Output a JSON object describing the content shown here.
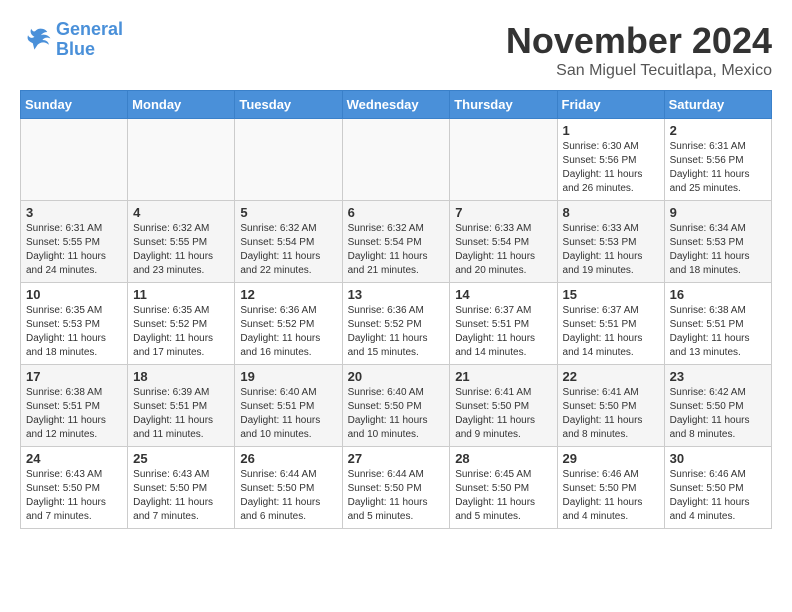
{
  "logo": {
    "line1": "General",
    "line2": "Blue"
  },
  "title": "November 2024",
  "location": "San Miguel Tecuitlapa, Mexico",
  "days_of_week": [
    "Sunday",
    "Monday",
    "Tuesday",
    "Wednesday",
    "Thursday",
    "Friday",
    "Saturday"
  ],
  "weeks": [
    {
      "days": [
        {
          "number": "",
          "info": ""
        },
        {
          "number": "",
          "info": ""
        },
        {
          "number": "",
          "info": ""
        },
        {
          "number": "",
          "info": ""
        },
        {
          "number": "",
          "info": ""
        },
        {
          "number": "1",
          "info": "Sunrise: 6:30 AM\nSunset: 5:56 PM\nDaylight: 11 hours and 26 minutes."
        },
        {
          "number": "2",
          "info": "Sunrise: 6:31 AM\nSunset: 5:56 PM\nDaylight: 11 hours and 25 minutes."
        }
      ]
    },
    {
      "days": [
        {
          "number": "3",
          "info": "Sunrise: 6:31 AM\nSunset: 5:55 PM\nDaylight: 11 hours and 24 minutes."
        },
        {
          "number": "4",
          "info": "Sunrise: 6:32 AM\nSunset: 5:55 PM\nDaylight: 11 hours and 23 minutes."
        },
        {
          "number": "5",
          "info": "Sunrise: 6:32 AM\nSunset: 5:54 PM\nDaylight: 11 hours and 22 minutes."
        },
        {
          "number": "6",
          "info": "Sunrise: 6:32 AM\nSunset: 5:54 PM\nDaylight: 11 hours and 21 minutes."
        },
        {
          "number": "7",
          "info": "Sunrise: 6:33 AM\nSunset: 5:54 PM\nDaylight: 11 hours and 20 minutes."
        },
        {
          "number": "8",
          "info": "Sunrise: 6:33 AM\nSunset: 5:53 PM\nDaylight: 11 hours and 19 minutes."
        },
        {
          "number": "9",
          "info": "Sunrise: 6:34 AM\nSunset: 5:53 PM\nDaylight: 11 hours and 18 minutes."
        }
      ]
    },
    {
      "days": [
        {
          "number": "10",
          "info": "Sunrise: 6:35 AM\nSunset: 5:53 PM\nDaylight: 11 hours and 18 minutes."
        },
        {
          "number": "11",
          "info": "Sunrise: 6:35 AM\nSunset: 5:52 PM\nDaylight: 11 hours and 17 minutes."
        },
        {
          "number": "12",
          "info": "Sunrise: 6:36 AM\nSunset: 5:52 PM\nDaylight: 11 hours and 16 minutes."
        },
        {
          "number": "13",
          "info": "Sunrise: 6:36 AM\nSunset: 5:52 PM\nDaylight: 11 hours and 15 minutes."
        },
        {
          "number": "14",
          "info": "Sunrise: 6:37 AM\nSunset: 5:51 PM\nDaylight: 11 hours and 14 minutes."
        },
        {
          "number": "15",
          "info": "Sunrise: 6:37 AM\nSunset: 5:51 PM\nDaylight: 11 hours and 14 minutes."
        },
        {
          "number": "16",
          "info": "Sunrise: 6:38 AM\nSunset: 5:51 PM\nDaylight: 11 hours and 13 minutes."
        }
      ]
    },
    {
      "days": [
        {
          "number": "17",
          "info": "Sunrise: 6:38 AM\nSunset: 5:51 PM\nDaylight: 11 hours and 12 minutes."
        },
        {
          "number": "18",
          "info": "Sunrise: 6:39 AM\nSunset: 5:51 PM\nDaylight: 11 hours and 11 minutes."
        },
        {
          "number": "19",
          "info": "Sunrise: 6:40 AM\nSunset: 5:51 PM\nDaylight: 11 hours and 10 minutes."
        },
        {
          "number": "20",
          "info": "Sunrise: 6:40 AM\nSunset: 5:50 PM\nDaylight: 11 hours and 10 minutes."
        },
        {
          "number": "21",
          "info": "Sunrise: 6:41 AM\nSunset: 5:50 PM\nDaylight: 11 hours and 9 minutes."
        },
        {
          "number": "22",
          "info": "Sunrise: 6:41 AM\nSunset: 5:50 PM\nDaylight: 11 hours and 8 minutes."
        },
        {
          "number": "23",
          "info": "Sunrise: 6:42 AM\nSunset: 5:50 PM\nDaylight: 11 hours and 8 minutes."
        }
      ]
    },
    {
      "days": [
        {
          "number": "24",
          "info": "Sunrise: 6:43 AM\nSunset: 5:50 PM\nDaylight: 11 hours and 7 minutes."
        },
        {
          "number": "25",
          "info": "Sunrise: 6:43 AM\nSunset: 5:50 PM\nDaylight: 11 hours and 7 minutes."
        },
        {
          "number": "26",
          "info": "Sunrise: 6:44 AM\nSunset: 5:50 PM\nDaylight: 11 hours and 6 minutes."
        },
        {
          "number": "27",
          "info": "Sunrise: 6:44 AM\nSunset: 5:50 PM\nDaylight: 11 hours and 5 minutes."
        },
        {
          "number": "28",
          "info": "Sunrise: 6:45 AM\nSunset: 5:50 PM\nDaylight: 11 hours and 5 minutes."
        },
        {
          "number": "29",
          "info": "Sunrise: 6:46 AM\nSunset: 5:50 PM\nDaylight: 11 hours and 4 minutes."
        },
        {
          "number": "30",
          "info": "Sunrise: 6:46 AM\nSunset: 5:50 PM\nDaylight: 11 hours and 4 minutes."
        }
      ]
    }
  ]
}
